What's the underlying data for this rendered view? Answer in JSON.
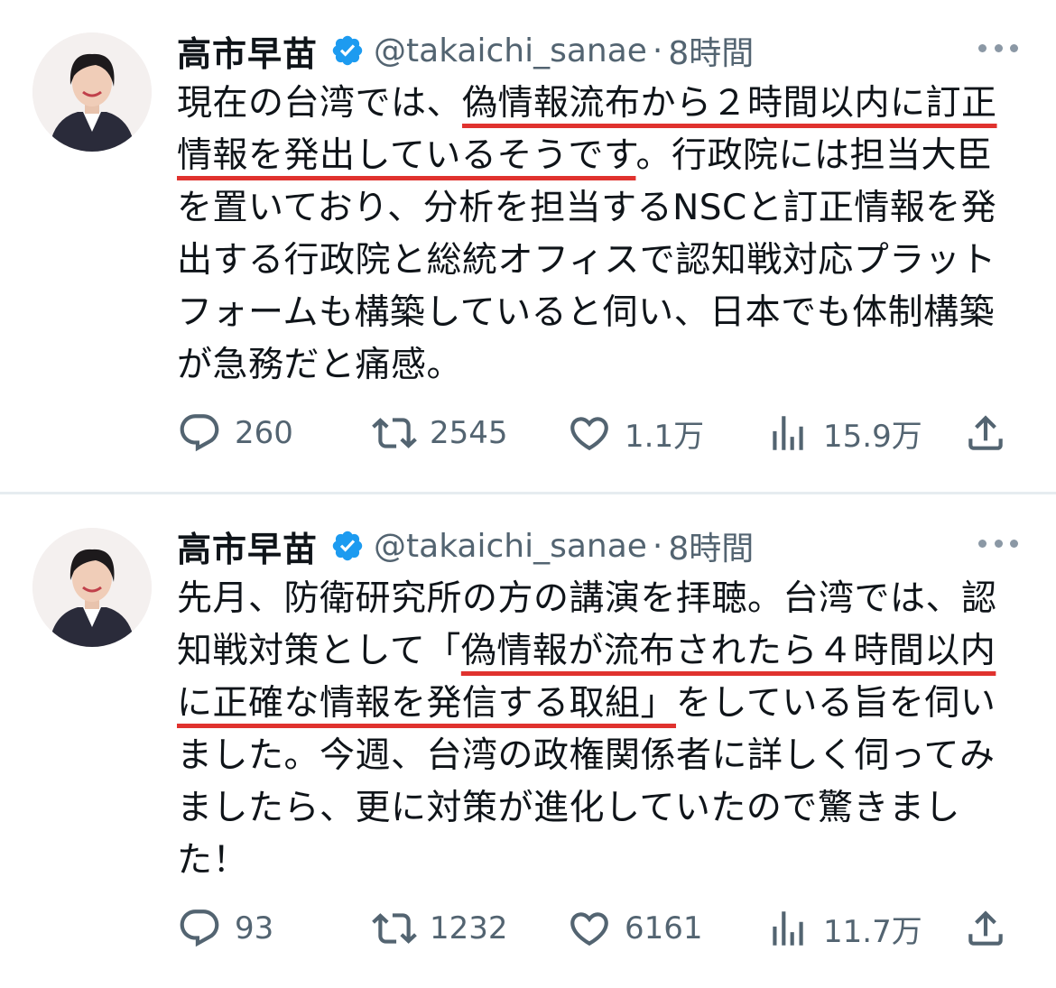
{
  "tweets": [
    {
      "author": {
        "display_name": "高市早苗",
        "handle": "@takaichi_sanae",
        "separator": "·",
        "time": "8時間",
        "verified_icon": "verified-badge-icon"
      },
      "text_segments": [
        {
          "text": "現在の台湾では、",
          "highlight": false
        },
        {
          "text": "偽情報流布から２時間以内に訂正情報を発出しているそうです",
          "highlight": true
        },
        {
          "text": "。行政院には担当大臣を置いており、分析を担当するNSCと訂正情報を発出する行政院と総統オフィスで認知戦対応プラットフォームも構築していると伺い、日本でも体制構築が急務だと痛感。",
          "highlight": false
        }
      ],
      "stats": {
        "replies": "260",
        "retweets": "2545",
        "likes": "1.1万",
        "views": "15.9万"
      }
    },
    {
      "author": {
        "display_name": "高市早苗",
        "handle": "@takaichi_sanae",
        "separator": "·",
        "time": "8時間",
        "verified_icon": "verified-badge-icon"
      },
      "text_segments": [
        {
          "text": "先月、防衛研究所の方の講演を拝聴。台湾では、認知戦対策として「",
          "highlight": false
        },
        {
          "text": "偽情報が流布されたら４時間以内に正確な情報を発信する取組」",
          "highlight": true
        },
        {
          "text": "をしている旨を伺いました。今週、台湾の政権関係者に詳しく伺ってみましたら、更に対策が進化していたので驚きました！",
          "highlight": false
        }
      ],
      "stats": {
        "replies": "93",
        "retweets": "1232",
        "likes": "6161",
        "views": "11.7万"
      }
    }
  ],
  "icons": {
    "reply": "reply-icon",
    "retweet": "retweet-icon",
    "like": "heart-icon",
    "views": "views-chart-icon",
    "share": "share-icon",
    "more": "more-dots-icon"
  },
  "colors": {
    "text": "#0f1419",
    "muted": "#536471",
    "verified": "#1d9bf0",
    "underline": "#e0322e",
    "divider": "#e6ecf0"
  }
}
